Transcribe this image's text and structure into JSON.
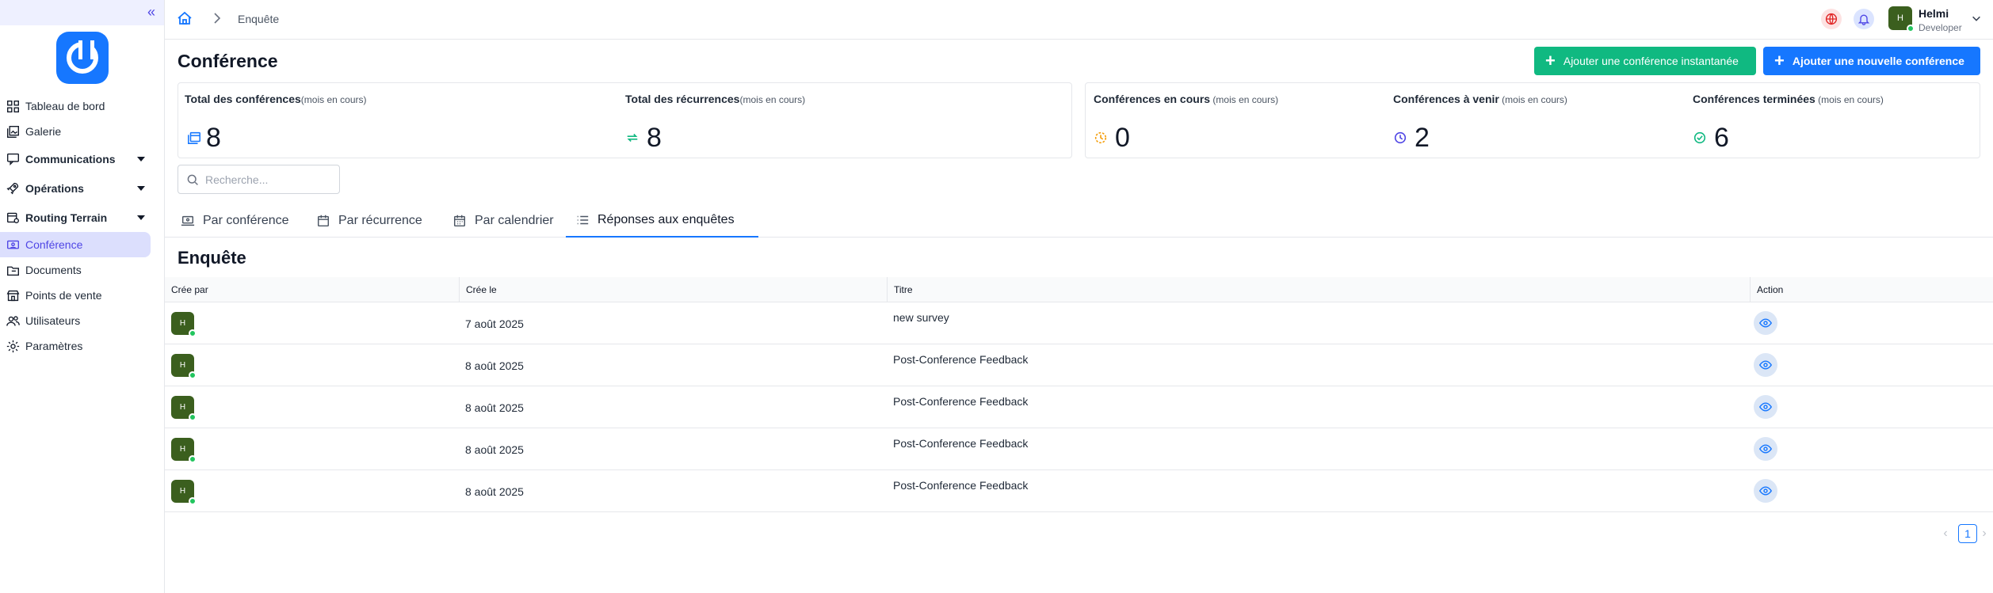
{
  "sidebar": {
    "collapse_glyph": "«",
    "items": [
      {
        "label": "Tableau de bord",
        "icon": "dashboard-icon"
      },
      {
        "label": "Galerie",
        "icon": "gallery-icon"
      },
      {
        "label": "Communications",
        "icon": "chat-icon"
      },
      {
        "label": "Opérations",
        "icon": "rocket-icon"
      },
      {
        "label": "Routing Terrain",
        "icon": "route-icon"
      },
      {
        "label": "Conférence",
        "icon": "conference-icon"
      },
      {
        "label": "Documents",
        "icon": "folder-icon"
      },
      {
        "label": "Points de vente",
        "icon": "store-icon"
      },
      {
        "label": "Utilisateurs",
        "icon": "users-icon"
      },
      {
        "label": "Paramètres",
        "icon": "gear-icon"
      }
    ]
  },
  "topbar": {
    "breadcrumb": "Enquête",
    "user": {
      "initial": "H",
      "name": "Helmi",
      "role": "Developer"
    }
  },
  "header": {
    "title": "Conférence",
    "btn_instant": "Ajouter une conférence instantanée",
    "btn_new": "Ajouter une nouvelle conférence"
  },
  "stats": {
    "total_conf": {
      "label": "Total des conférences",
      "note": "(mois en cours)",
      "value": "8"
    },
    "total_rec": {
      "label": "Total des récurrences",
      "note": "(mois en cours)",
      "value": "8"
    },
    "in_progress": {
      "label": "Conférences en cours",
      "note": " (mois en cours)",
      "value": "0"
    },
    "upcoming": {
      "label": "Conférences à venir",
      "note": " (mois en cours)",
      "value": "2"
    },
    "done": {
      "label": "Conférences terminées",
      "note": " (mois en cours)",
      "value": "6"
    }
  },
  "search": {
    "placeholder": "Recherche..."
  },
  "tabs": {
    "by_conf": "Par conférence",
    "by_rec": "Par récurrence",
    "by_cal": "Par calendrier",
    "responses": "Réponses aux enquêtes"
  },
  "table": {
    "title": "Enquête",
    "headers": {
      "creator": "Crée par",
      "created": "Crée le",
      "title": "Titre",
      "action": "Action"
    },
    "rows": [
      {
        "initial": "H",
        "date": "7 août 2025",
        "title": "new survey"
      },
      {
        "initial": "H",
        "date": "8 août 2025",
        "title": "Post-Conference Feedback"
      },
      {
        "initial": "H",
        "date": "8 août 2025",
        "title": "Post-Conference Feedback"
      },
      {
        "initial": "H",
        "date": "8 août 2025",
        "title": "Post-Conference Feedback"
      },
      {
        "initial": "H",
        "date": "8 août 2025",
        "title": "Post-Conference Feedback"
      }
    ]
  },
  "pagination": {
    "prev": "‹",
    "current": "1",
    "next": "›"
  },
  "colors": {
    "primary": "#1677ff",
    "success": "#10b981",
    "active_nav_bg": "#dcdffd",
    "avatar": "#3b5f1e"
  }
}
